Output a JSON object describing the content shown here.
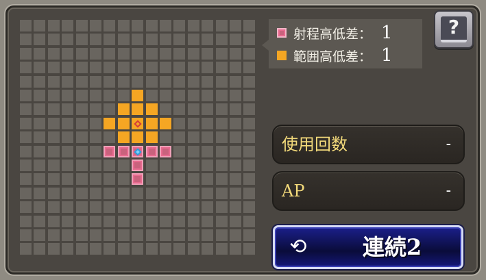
{
  "legend": {
    "range_height": {
      "label": "射程高低差：",
      "value": "1",
      "color": "#e86a8f"
    },
    "area_height": {
      "label": "範囲高低差：",
      "value": "1",
      "color": "#f5a623"
    }
  },
  "help_button": {
    "icon": "question-book-icon",
    "glyph": "?"
  },
  "stats": {
    "uses": {
      "label": "使用回数",
      "value": "-"
    },
    "ap": {
      "label": "AP",
      "value": "-"
    }
  },
  "chain_button": {
    "icon": "cycle-arrows-icon",
    "glyph": "⟲",
    "label": "連続2"
  },
  "grid": {
    "size": 17,
    "area_cells": [
      [
        8,
        5
      ],
      [
        7,
        6
      ],
      [
        8,
        6
      ],
      [
        9,
        6
      ],
      [
        6,
        7
      ],
      [
        7,
        7
      ],
      [
        8,
        7
      ],
      [
        9,
        7
      ],
      [
        10,
        7
      ],
      [
        7,
        8
      ],
      [
        8,
        8
      ],
      [
        9,
        8
      ]
    ],
    "range_cells": [
      [
        6,
        9
      ],
      [
        7,
        9
      ],
      [
        8,
        9
      ],
      [
        9,
        9
      ],
      [
        10,
        9
      ],
      [
        8,
        10
      ],
      [
        8,
        11
      ]
    ],
    "caster_cell": [
      8,
      9
    ],
    "target_cell": [
      8,
      7
    ]
  }
}
